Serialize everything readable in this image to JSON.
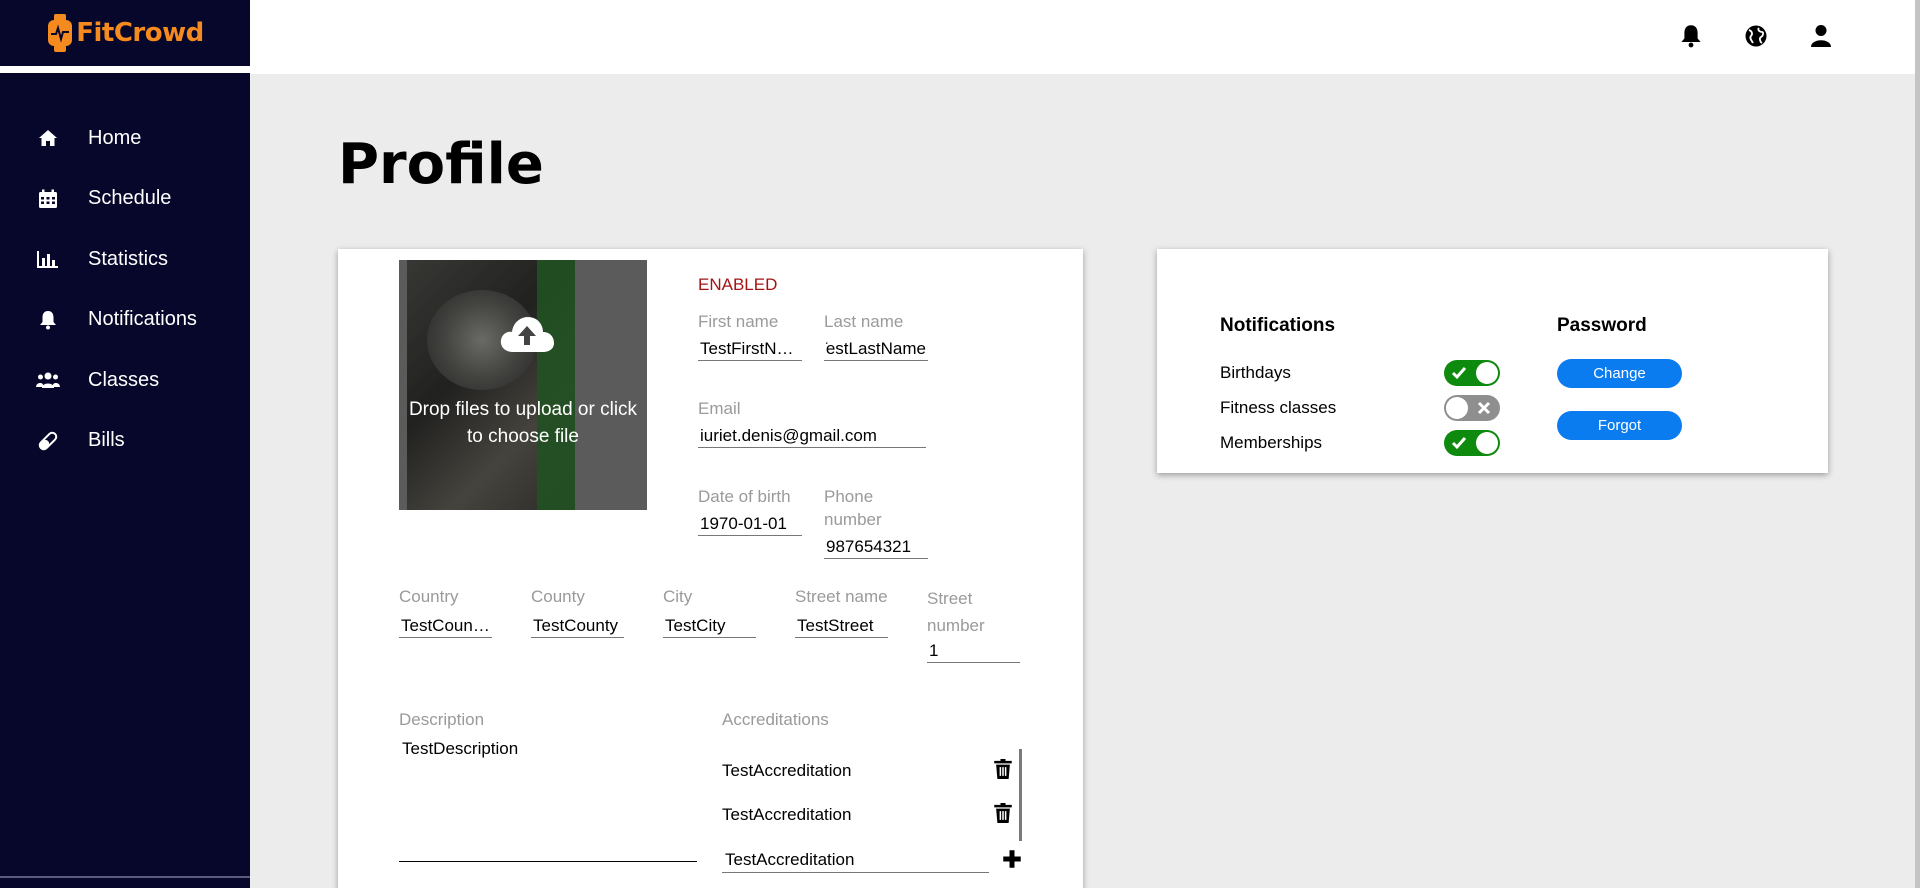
{
  "app": {
    "name": "FitCrowd",
    "brand_color": "#f58a1f"
  },
  "sidebar": {
    "items": [
      {
        "label": "Home",
        "icon": "home-icon"
      },
      {
        "label": "Schedule",
        "icon": "calendar-icon"
      },
      {
        "label": "Statistics",
        "icon": "bar-chart-icon"
      },
      {
        "label": "Notifications",
        "icon": "bell-icon"
      },
      {
        "label": "Classes",
        "icon": "users-icon"
      },
      {
        "label": "Bills",
        "icon": "pill-icon"
      }
    ]
  },
  "topbar": {
    "icons": [
      "bell-icon",
      "globe-icon",
      "user-icon"
    ]
  },
  "page": {
    "title": "Profile"
  },
  "profile": {
    "upload_text": "Drop files to upload or click to choose file",
    "status": "ENABLED",
    "first_name": {
      "label": "First name",
      "value": "TestFirstName"
    },
    "last_name": {
      "label": "Last name",
      "value": "TestLastName"
    },
    "email": {
      "label": "Email",
      "value": "iuriet.denis@gmail.com"
    },
    "dob": {
      "label": "Date of birth",
      "value": "1970-01-01"
    },
    "phone": {
      "label": "Phone number",
      "value": "987654321"
    },
    "country": {
      "label": "Country",
      "value": "TestCountry"
    },
    "county": {
      "label": "County",
      "value": "TestCounty"
    },
    "city": {
      "label": "City",
      "value": "TestCity"
    },
    "street_name": {
      "label": "Street name",
      "value": "TestStreet"
    },
    "street_number": {
      "label": "Street number",
      "value": "1"
    },
    "description": {
      "label": "Description",
      "value": "TestDescription"
    },
    "accreditations": {
      "label": "Accreditations",
      "items": [
        "TestAccreditation",
        "TestAccreditation"
      ],
      "new_value": "TestAccreditation"
    }
  },
  "settings": {
    "notifications": {
      "heading": "Notifications",
      "items": [
        {
          "label": "Birthdays",
          "on": true
        },
        {
          "label": "Fitness classes",
          "on": false
        },
        {
          "label": "Memberships",
          "on": true
        }
      ]
    },
    "password": {
      "heading": "Password",
      "change_label": "Change",
      "forgot_label": "Forgot"
    }
  },
  "colors": {
    "sidebar_bg": "#07072b",
    "toggle_on": "#0e8a0e",
    "toggle_off": "#8f8f8f",
    "button_blue": "#0b7cf0",
    "status_red": "#a31515"
  }
}
